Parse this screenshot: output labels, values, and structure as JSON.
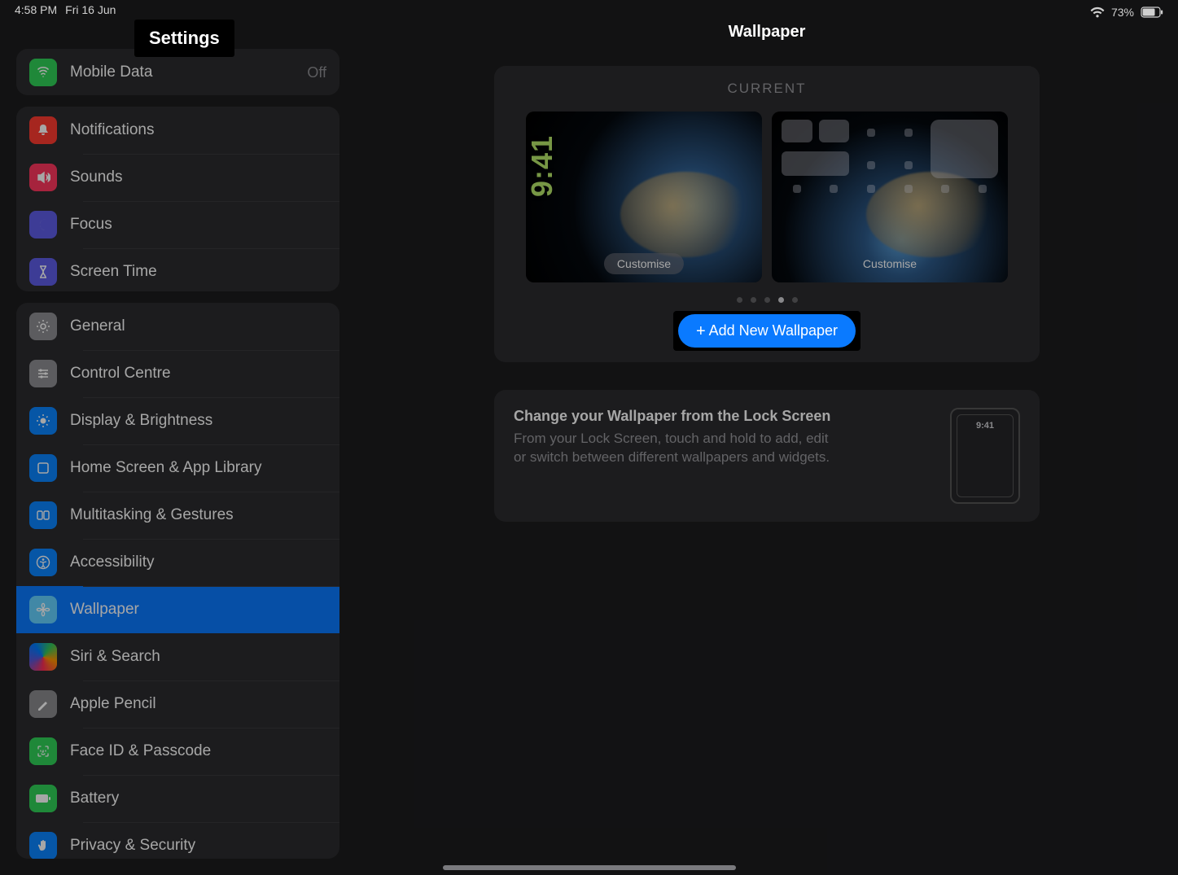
{
  "status": {
    "time": "4:58 PM",
    "date": "Fri 16 Jun",
    "battery_pct": "73%"
  },
  "sidebar": {
    "title": "Settings",
    "group0": {
      "mobile_data": {
        "label": "Mobile Data",
        "value": "Off"
      }
    },
    "group1": {
      "notifications": "Notifications",
      "sounds": "Sounds",
      "focus": "Focus",
      "screen_time": "Screen Time"
    },
    "group2": {
      "general": "General",
      "control_centre": "Control Centre",
      "display": "Display & Brightness",
      "home_screen": "Home Screen & App Library",
      "multitasking": "Multitasking & Gestures",
      "accessibility": "Accessibility",
      "wallpaper": "Wallpaper",
      "siri": "Siri & Search",
      "pencil": "Apple Pencil",
      "faceid": "Face ID & Passcode",
      "battery": "Battery",
      "privacy": "Privacy & Security"
    }
  },
  "detail": {
    "title": "Wallpaper",
    "current_label": "CURRENT",
    "lock_clock": "9:41",
    "customise": "Customise",
    "add_new": "Add New Wallpaper",
    "dots": {
      "count": 5,
      "active_index": 3
    },
    "info": {
      "heading": "Change your Wallpaper from the Lock Screen",
      "body": "From your Lock Screen, touch and hold to add, edit or switch between different wallpapers and widgets.",
      "mini_clock": "9:41"
    }
  }
}
